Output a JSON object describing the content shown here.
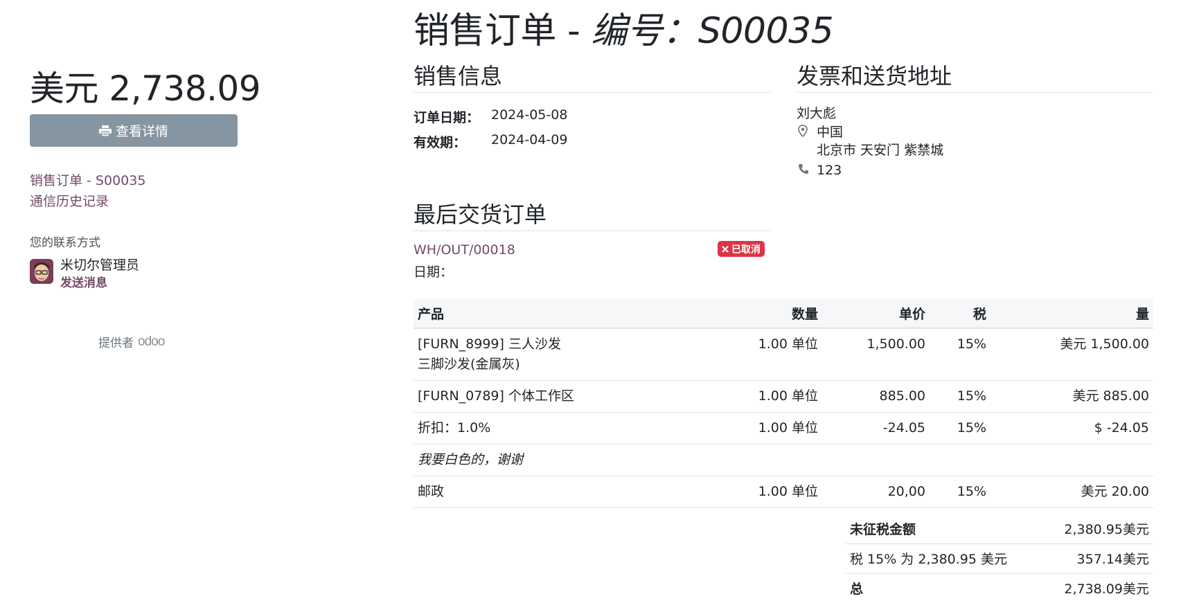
{
  "sidebar": {
    "amount": "美元 2,738.09",
    "details_button": "查看详情",
    "link_order": "销售订单 - S00035",
    "link_history": "通信历史记录",
    "contact_label": "您的联系方式",
    "contact_name": "米切尔管理员",
    "send_message": "发送消息",
    "powered_by": "提供者",
    "odoo_logo": "odoo"
  },
  "header": {
    "title_prefix": "销售订单 - ",
    "title_number": "编号：S00035"
  },
  "sales_info": {
    "title": "销售信息",
    "order_date_label": "订单日期：",
    "order_date": "2024-05-08",
    "validity_label": "有效期：",
    "validity": "2024-04-09"
  },
  "address": {
    "title": "发票和送货地址",
    "name": "刘大彪",
    "country": "中国",
    "street": "北京市 天安门 紫禁城",
    "phone": "123"
  },
  "delivery": {
    "title": "最后交货订单",
    "reference": "WH/OUT/00018",
    "status": "已取消",
    "date_label": "日期："
  },
  "lines": {
    "headers": [
      "产品",
      "数量",
      "单价",
      "税",
      "量"
    ],
    "rows": [
      {
        "product": "[FURN_8999] 三人沙发",
        "product_desc": "三脚沙发(金属灰)",
        "qty": "1.00 单位",
        "price": "1,500.00",
        "tax": "15%",
        "amount": "美元 1,500.00"
      },
      {
        "product": "[FURN_0789] 个体工作区",
        "qty": "1.00 单位",
        "price": "885.00",
        "tax": "15%",
        "amount": "美元 885.00"
      },
      {
        "product": "折扣：1.0%",
        "qty": "1.00 单位",
        "price": "-24.05",
        "tax": "15%",
        "amount": "$  -24.05"
      },
      {
        "note": "我要白色的，谢谢"
      },
      {
        "product": "邮政",
        "qty": "1.00 单位",
        "price": "20,00",
        "tax": "15%",
        "amount": "美元 20.00"
      }
    ]
  },
  "totals": {
    "untaxed_label": "未征税金额",
    "untaxed": "2,380.95美元",
    "tax_label": "税 15% 为 2,380.95 美元",
    "tax": "357.14美元",
    "total_label": "总",
    "total": "2,738.09美元"
  },
  "colors": {
    "accent": "#714b67",
    "button_bg": "#8595a2",
    "badge_danger": "#dc3545",
    "rule": "#dee2e6"
  }
}
